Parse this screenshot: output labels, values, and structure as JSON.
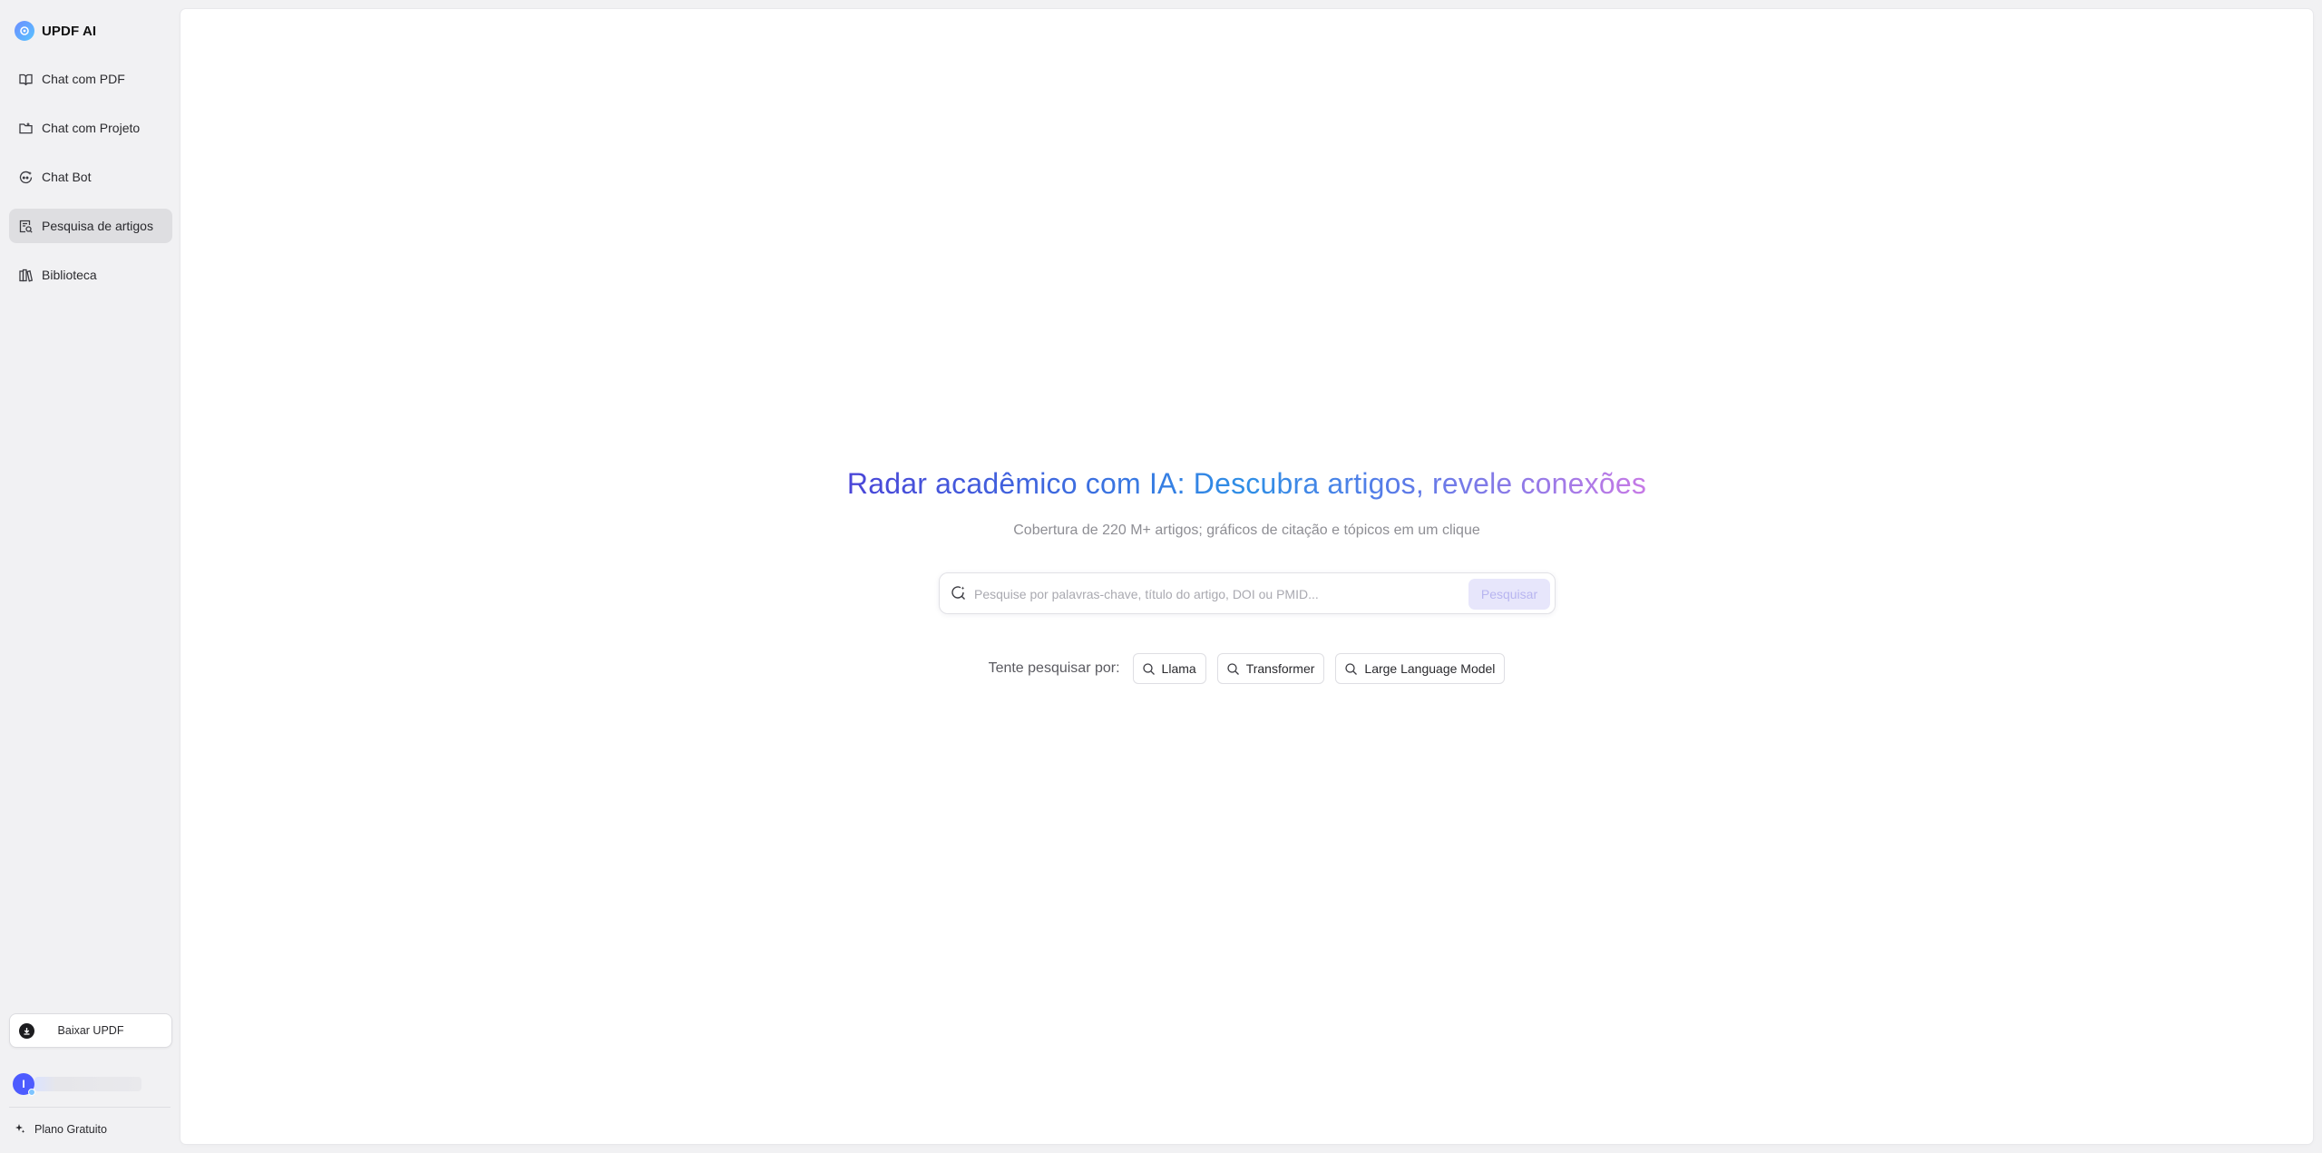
{
  "brand": {
    "name": "UPDF AI",
    "logo_icon": "updf-logo-icon"
  },
  "sidebar": {
    "items": [
      {
        "label": "Chat com PDF",
        "icon": "book-open-icon",
        "active": false
      },
      {
        "label": "Chat com Projeto",
        "icon": "folder-icon",
        "active": false
      },
      {
        "label": "Chat Bot",
        "icon": "chat-bot-icon",
        "active": false
      },
      {
        "label": "Pesquisa de artigos",
        "icon": "article-search-icon",
        "active": true
      },
      {
        "label": "Biblioteca",
        "icon": "library-icon",
        "active": false
      }
    ],
    "download_label": "Baixar UPDF",
    "user_initial": "I",
    "plan_label": "Plano Gratuito"
  },
  "hero": {
    "title": "Radar acadêmico com IA: Descubra artigos, revele conexões",
    "subtitle": "Cobertura de 220 M+ artigos; gráficos de citação e tópicos em um clique"
  },
  "search": {
    "placeholder": "Pesquise por palavras-chave, título do artigo, DOI ou PMID...",
    "value": "",
    "button_label": "Pesquisar"
  },
  "suggestions": {
    "label": "Tente pesquisar por:",
    "chips": [
      "Llama",
      "Transformer",
      "Large Language Model"
    ]
  },
  "colors": {
    "accent": "#4d5bff",
    "title_gradient_start": "#4a45d8",
    "title_gradient_mid": "#2f8fe6",
    "title_gradient_end": "#c77ae6",
    "active_nav_bg": "#dedee1",
    "search_button_bg": "#e7e6fb"
  }
}
